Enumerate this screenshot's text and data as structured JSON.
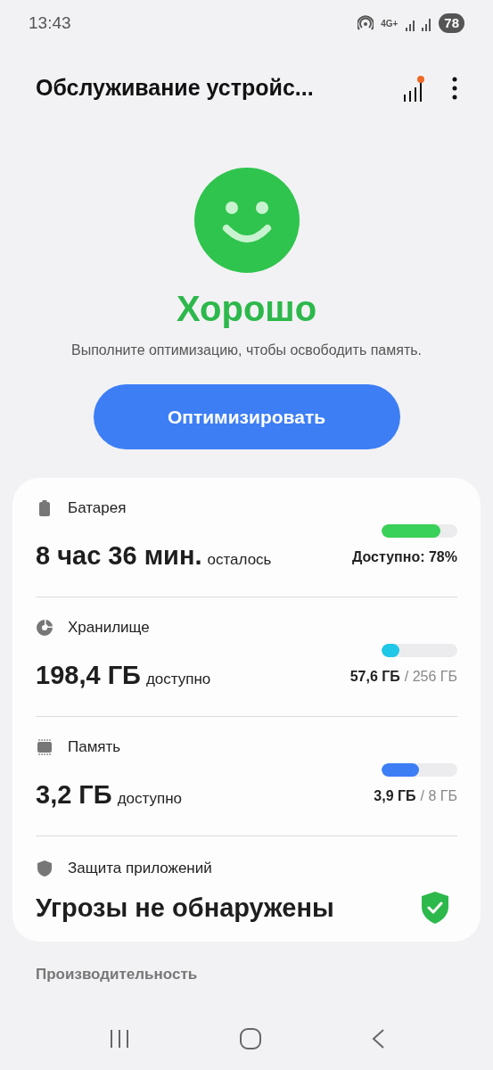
{
  "status_bar": {
    "time": "13:43",
    "network": "4G+",
    "battery": "78"
  },
  "header": {
    "title": "Обслуживание устройс..."
  },
  "summary": {
    "status": "Хорошо",
    "message": "Выполните оптимизацию, чтобы освободить память.",
    "button": "Оптимизировать"
  },
  "items": [
    {
      "kind": "meter",
      "label": "Батарея",
      "value": "8 час 36 мин.",
      "suffix": "осталось",
      "level": 0.78,
      "color": "#3ad15a",
      "reading": "Доступно: 78%"
    },
    {
      "kind": "meter",
      "label": "Хранилище",
      "value": "198,4 ГБ",
      "suffix": "доступно",
      "level": 0.23,
      "color": "#1ec8e6",
      "used": "57,6 ГБ",
      "total": "/ 256 ГБ"
    },
    {
      "kind": "meter",
      "label": "Память",
      "value": "3,2 ГБ",
      "suffix": "доступно",
      "level": 0.49,
      "color": "#3d7ef5",
      "used": "3,9 ГБ",
      "total": "/ 8 ГБ"
    },
    {
      "kind": "status",
      "label": "Защита приложений",
      "value": "Угрозы не обнаружены"
    }
  ],
  "next_section": "Производительность"
}
